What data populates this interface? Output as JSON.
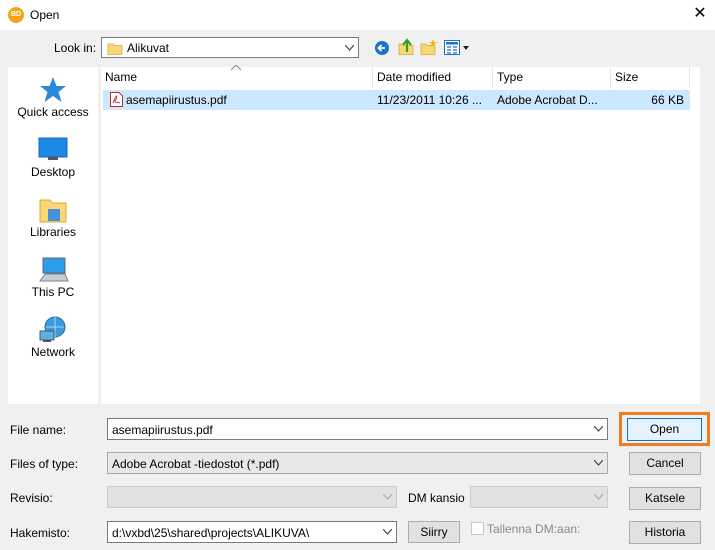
{
  "window": {
    "title": "Open",
    "app_icon_text": "BD"
  },
  "toolbar": {
    "look_in_label": "Look in:",
    "look_in_value": "Alikuvat"
  },
  "places": [
    {
      "label": "Quick access",
      "icon": "star-icon"
    },
    {
      "label": "Desktop",
      "icon": "desktop-icon"
    },
    {
      "label": "Libraries",
      "icon": "libraries-icon"
    },
    {
      "label": "This PC",
      "icon": "computer-icon"
    },
    {
      "label": "Network",
      "icon": "network-icon"
    }
  ],
  "columns": {
    "name": "Name",
    "date": "Date modified",
    "type": "Type",
    "size": "Size"
  },
  "files": [
    {
      "name": "asemapiirustus.pdf",
      "date": "11/23/2011 10:26 ...",
      "type": "Adobe Acrobat D...",
      "size": "66 KB"
    }
  ],
  "form": {
    "file_name_label": "File name:",
    "file_name_value": "asemapiirustus.pdf",
    "files_of_type_label": "Files of type:",
    "files_of_type_value": "Adobe Acrobat -tiedostot (*.pdf)",
    "revisio_label": "Revisio:",
    "dm_kansio_label": "DM kansio",
    "hakemisto_label": "Hakemisto:",
    "hakemisto_value": "d:\\vxbd\\25\\shared\\projects\\ALIKUVA\\",
    "siirry_label": "Siirry",
    "tallenna_label": "Tallenna DM:aan:"
  },
  "buttons": {
    "open": "Open",
    "cancel": "Cancel",
    "katsele": "Katsele",
    "historia": "Historia"
  },
  "colors": {
    "accent": "#f4791f",
    "selection": "#cce8ff"
  }
}
